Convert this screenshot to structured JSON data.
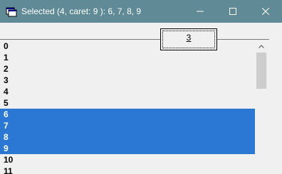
{
  "window": {
    "title": "Selected (4, caret: 9 ): 6, 7, 8, 9",
    "app_icon": "window-app-icon",
    "controls": {
      "minimize_icon": "minimize-icon",
      "maximize_icon": "maximize-icon",
      "close_icon": "close-icon"
    }
  },
  "button": {
    "label": "3"
  },
  "listbox": {
    "items": [
      "0",
      "1",
      "2",
      "3",
      "4",
      "5",
      "6",
      "7",
      "8",
      "9",
      "10",
      "11"
    ],
    "selected": [
      "6",
      "7",
      "8",
      "9"
    ],
    "selection_color": "#2a78d4"
  },
  "colors": {
    "titlebar": "#5f8a96",
    "background": "#f0f0f0"
  }
}
